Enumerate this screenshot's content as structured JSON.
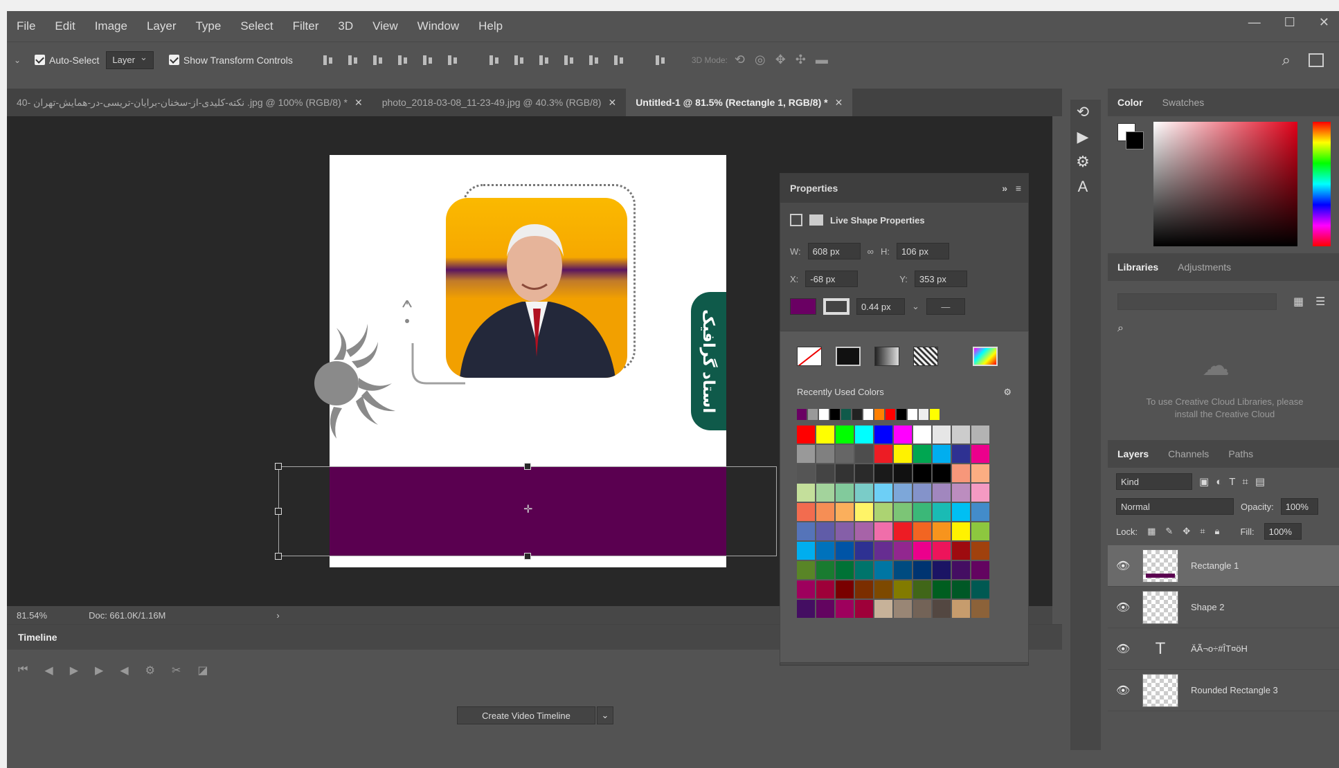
{
  "menu": [
    "File",
    "Edit",
    "Image",
    "Layer",
    "Type",
    "Select",
    "Filter",
    "3D",
    "View",
    "Window",
    "Help"
  ],
  "window_controls": [
    "—",
    "☐",
    "✕"
  ],
  "options": {
    "auto_select_label": "Auto-Select",
    "auto_select_value": "Layer",
    "show_transform_label": "Show Transform Controls",
    "mode_3d_label": "3D Mode:"
  },
  "tabs": [
    {
      "label": "40- نکته-کلیدی-از-سخنان-برایان-تریسی-در-همایش-تهران .jpg @ 100% (RGB/8) *"
    },
    {
      "label": "photo_2018-03-08_11-23-49.jpg @ 40.3% (RGB/8)"
    },
    {
      "label": "Untitled-1 @ 81.5% (Rectangle 1, RGB/8) *"
    }
  ],
  "canvas": {
    "badge_text": "استاد گرافیک",
    "accent_color": "#5a0050"
  },
  "status": {
    "zoom": "81.54%",
    "doc": "Doc: 661.0K/1.16M"
  },
  "properties": {
    "title": "Properties",
    "subtitle": "Live Shape Properties",
    "w_label": "W:",
    "w": "608 px",
    "h_label": "H:",
    "h": "106 px",
    "x_label": "X:",
    "x": "-68 px",
    "y_label": "Y:",
    "y": "353 px",
    "stroke": "0.44 px",
    "fill_color": "#6a0063"
  },
  "swatches": {
    "title": "Recently Used Colors",
    "recent": [
      "#6a0063",
      "#999999",
      "#ffffff",
      "#000000",
      "#0f5a4a",
      "#222222",
      "#ffffff",
      "#ff7f00",
      "#ff0000",
      "#000000",
      "#ffffff",
      "#eeeeee",
      "#ffff00"
    ],
    "grid": [
      "#ff0000",
      "#ffff00",
      "#00ff00",
      "#00ffff",
      "#0000ff",
      "#ff00ff",
      "#ffffff",
      "#e6e6e6",
      "#cccccc",
      "#b3b3b3",
      "#999999",
      "#808080",
      "#666666",
      "#4d4d4d",
      "#ed1c24",
      "#fff200",
      "#00a651",
      "#00aeef",
      "#2e3192",
      "#ec008c",
      "#555555",
      "#444444",
      "#333333",
      "#2a2a2a",
      "#1a1a1a",
      "#111111",
      "#000000",
      "#000000",
      "#f7977a",
      "#fbad82",
      "#c4df9b",
      "#a3d39c",
      "#82ca9c",
      "#7accc8",
      "#6dcff6",
      "#7da7d9",
      "#8493ca",
      "#a187be",
      "#bc8dbf",
      "#f49ac2",
      "#f26c4f",
      "#f68e55",
      "#fbaf5c",
      "#fff467",
      "#acd372",
      "#7cc576",
      "#3bb878",
      "#1abbb4",
      "#00bff3",
      "#438cca",
      "#5574b9",
      "#605ca8",
      "#855fa8",
      "#a763a8",
      "#f06eaa",
      "#ed1c24",
      "#f26522",
      "#f7941d",
      "#fff200",
      "#8dc73f",
      "#00aeef",
      "#0072bc",
      "#0054a6",
      "#2e3192",
      "#662d91",
      "#92278f",
      "#ec008c",
      "#ed145b",
      "#9e0b0f",
      "#a0410d",
      "#598527",
      "#197b30",
      "#007236",
      "#00746b",
      "#0076a3",
      "#004b80",
      "#003471",
      "#1b1464",
      "#440e62",
      "#630460",
      "#9e005d",
      "#9e0039",
      "#790000",
      "#7b2e00",
      "#7d4900",
      "#827b00",
      "#406618",
      "#005e20",
      "#005826",
      "#005952",
      "#440e62",
      "#630460",
      "#9e005d",
      "#9e0039",
      "#c7b299",
      "#998675",
      "#736357",
      "#534741",
      "#c69c6d",
      "#8c6239"
    ]
  },
  "right": {
    "color_tabs": [
      "Color",
      "Swatches"
    ],
    "lib_tabs": [
      "Libraries",
      "Adjustments"
    ],
    "cc_message": "To use Creative Cloud Libraries, please install the Creative Cloud",
    "layer_tabs": [
      "Layers",
      "Channels",
      "Paths"
    ],
    "kind": "Kind",
    "blend": "Normal",
    "opacity_label": "Opacity:",
    "opacity": "100%",
    "lock_label": "Lock:",
    "fill_label": "Fill:",
    "fill": "100%",
    "layers": [
      {
        "name": "Rectangle 1"
      },
      {
        "name": "Shape 2"
      },
      {
        "name": "ÄÃ¬o÷#ÎT¤öH"
      },
      {
        "name": "Rounded Rectangle 3"
      }
    ]
  },
  "timeline": {
    "title": "Timeline",
    "create_button": "Create Video Timeline"
  }
}
